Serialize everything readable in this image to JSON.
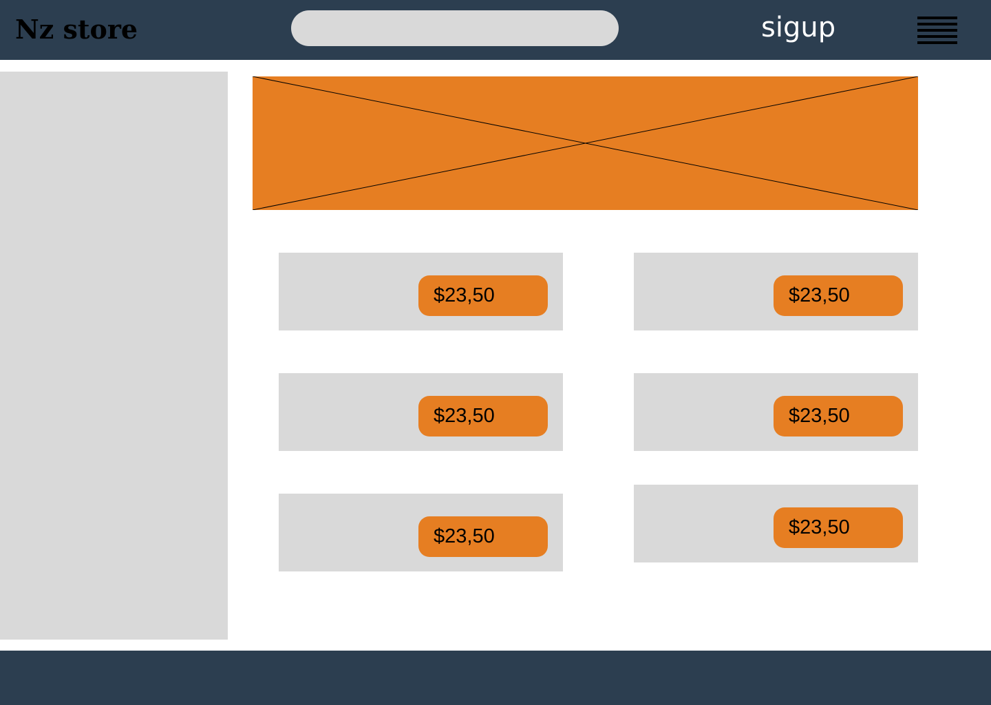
{
  "header": {
    "logo": "Nz store",
    "search": {
      "value": "",
      "placeholder": ""
    },
    "signup_label": "sigup"
  },
  "products": [
    {
      "price": "$23,50"
    },
    {
      "price": "$23,50"
    },
    {
      "price": "$23,50"
    },
    {
      "price": "$23,50"
    },
    {
      "price": "$23,50"
    },
    {
      "price": "$23,50"
    }
  ],
  "colors": {
    "header_bg": "#2c3e50",
    "accent": "#e67e22",
    "placeholder_gray": "#d9d9d9"
  },
  "icons": {
    "menu": "hamburger-menu-icon",
    "banner": "image-placeholder-icon"
  }
}
